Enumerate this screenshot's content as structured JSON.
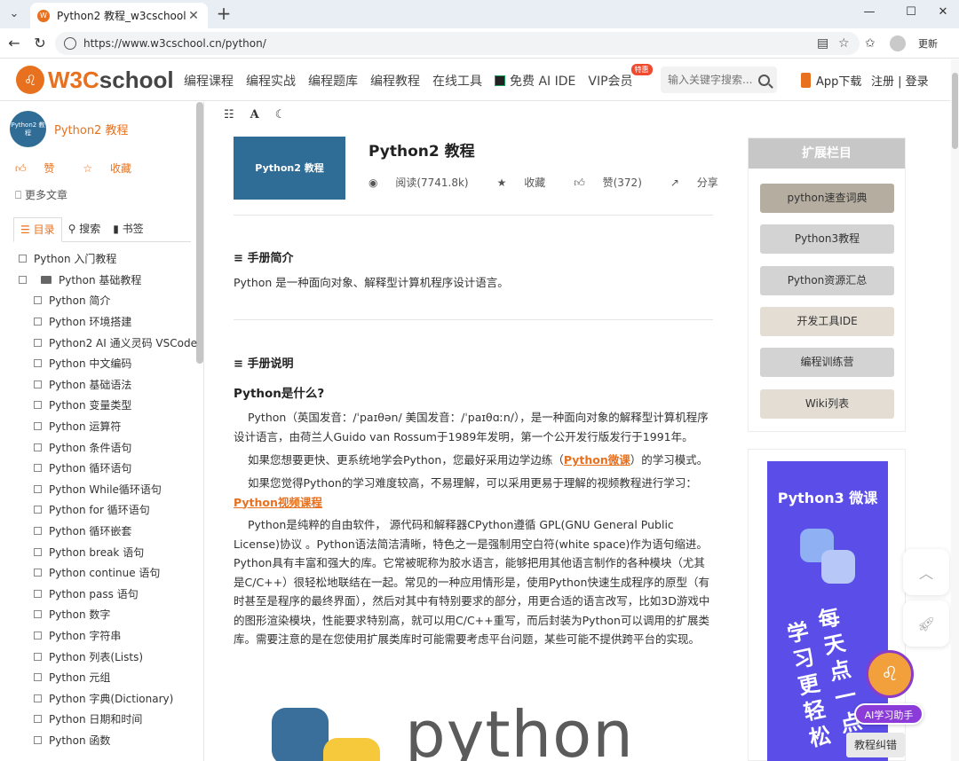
{
  "browser": {
    "tab_title": "Python2 教程_w3cschool",
    "url": "https://www.w3cschool.cn/python/",
    "update_label": "更新"
  },
  "header": {
    "logo_prefix": "W3C",
    "logo_suffix": "school",
    "nav": [
      "编程课程",
      "编程实战",
      "编程题库",
      "编程教程",
      "在线工具",
      "免费 AI IDE",
      "VIP会员"
    ],
    "vip_tag": "特惠",
    "search_placeholder": "输入关键字搜索...",
    "app_download": "App下载",
    "register": "注册",
    "login": "登录"
  },
  "sidebar": {
    "course_avatar_text": "Python2 教程",
    "course_name": "Python2 教程",
    "like": "赞",
    "favorite": "收藏",
    "more_articles": "更多文章",
    "tabs": [
      "目录",
      "搜索",
      "书签"
    ],
    "toc_top": "Python 入门教程",
    "toc_group": "Python 基础教程",
    "toc_children": [
      "Python 简介",
      "Python 环境搭建",
      "Python2 AI 通义灵码 VSCode",
      "Python 中文编码",
      "Python 基础语法",
      "Python 变量类型",
      "Python 运算符",
      "Python 条件语句",
      "Python 循环语句",
      "Python While循环语句",
      "Python for 循环语句",
      "Python 循环嵌套",
      "Python break 语句",
      "Python continue 语句",
      "Python pass 语句",
      "Python 数字",
      "Python 字符串",
      "Python 列表(Lists)",
      "Python 元组",
      "Python 字典(Dictionary)",
      "Python 日期和时间",
      "Python 函数"
    ]
  },
  "content": {
    "hero_image_text": "Python2 教程",
    "title": "Python2 教程",
    "meta": {
      "reads": "阅读(7741.8k)",
      "favorite": "收藏",
      "likes": "赞(372)",
      "share": "分享"
    },
    "section1_title": "手册简介",
    "section1_text": "Python 是一种面向对象、解释型计算机程序设计语言。",
    "section2_title": "手册说明",
    "h3": "Python是什么?",
    "p1": "Python（英国发音：/ˈpaɪθən/ 美国发音：/ˈpaɪθɑːn/），是一种面向对象的解释型计算机程序设计语言，由荷兰人Guido van Rossum于1989年发明，第一个公开发行版发行于1991年。",
    "p2_before": "如果您想要更快、更系统地学会Python，您最好采用边学边练（",
    "p2_link": "Python微课",
    "p2_after": "）的学习模式。",
    "p3_before": "如果您觉得Python的学习难度较高，不易理解，可以采用更易于理解的视频教程进行学习：",
    "p3_link": "Python视频课程",
    "p4": "Python是纯粹的自由软件， 源代码和解释器CPython遵循 GPL(GNU General Public License)协议 。Python语法简洁清晰，特色之一是强制用空白符(white space)作为语句缩进。Python具有丰富和强大的库。它常被昵称为胶水语言，能够把用其他语言制作的各种模块（尤其是C/C++）很轻松地联结在一起。常见的一种应用情形是，使用Python快速生成程序的原型（有时甚至是程序的最终界面），然后对其中有特别要求的部分，用更合适的语言改写，比如3D游戏中的图形渲染模块，性能要求特别高，就可以用C/C++重写，而后封装为Python可以调用的扩展类库。需要注意的是在您使用扩展类库时可能需要考虑平台问题，某些可能不提供跨平台的实现。",
    "logo_word": "python"
  },
  "right": {
    "ext_title": "扩展栏目",
    "ext_items": [
      "python速查词典",
      "Python3教程",
      "Python资源汇总",
      "开发工具IDE",
      "编程训练营",
      "Wiki列表"
    ],
    "ext_colors": [
      "#b5ada0",
      "#d3d3d3",
      "#d3d3d3",
      "#e3ddd3",
      "#d3d3d3",
      "#e3ddd3"
    ],
    "ad_title": "Python3 微课",
    "ad_slogan_left": "学习更轻松",
    "ad_slogan_right": "每天点一点",
    "ai_assistant": "AI学习助手",
    "feedback": "教程纠错"
  }
}
